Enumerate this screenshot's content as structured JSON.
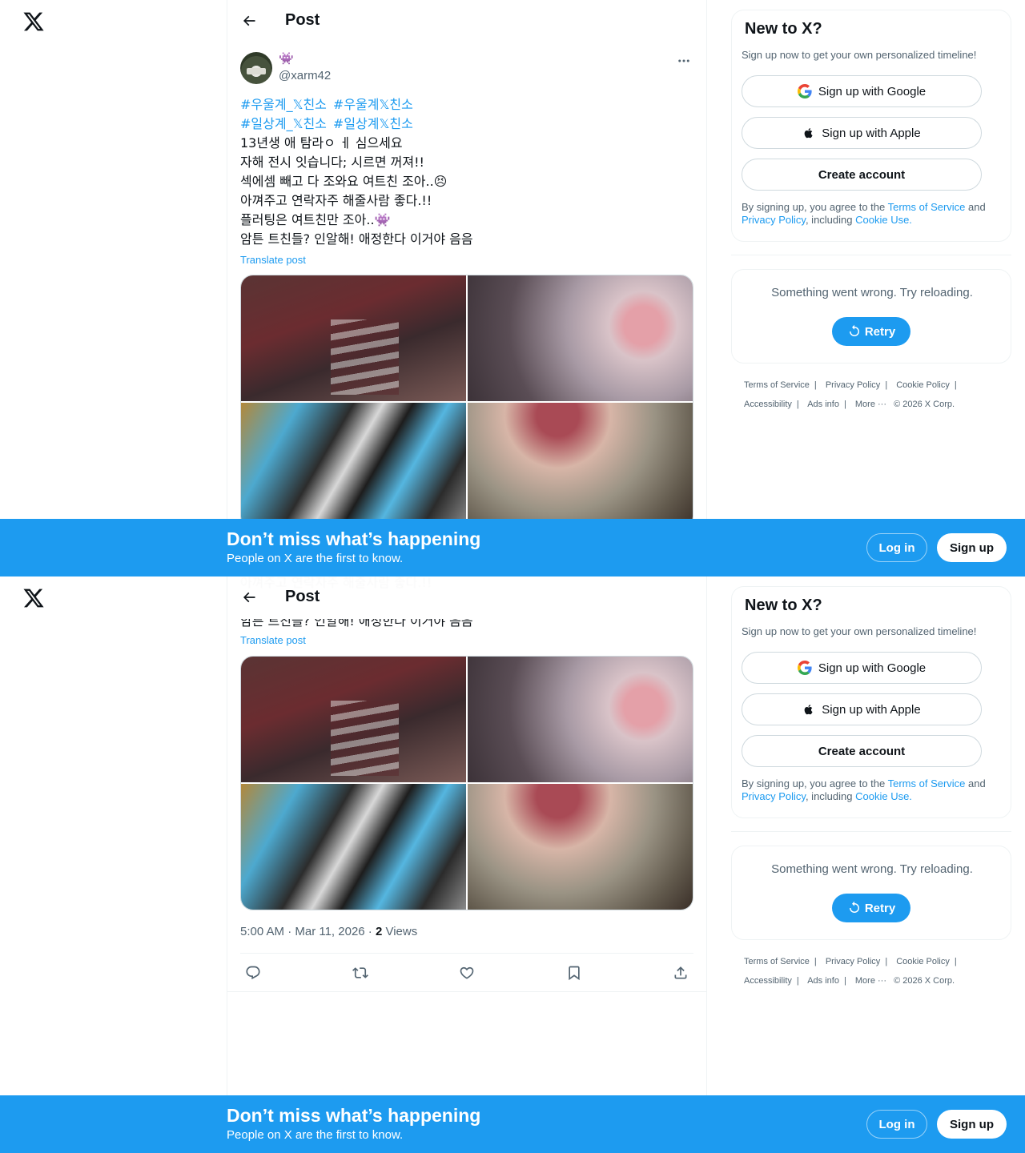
{
  "header": {
    "title": "Post"
  },
  "post": {
    "display_name": "👾",
    "handle": "@xarm42",
    "hashtags_line1": [
      "#우울계_𝕏친소",
      "#우울계𝕏친소"
    ],
    "hashtags_line2": [
      "#일상계_𝕏친소",
      "#일상계𝕏친소"
    ],
    "lines": [
      "13년생 애 탐라ㅇ ㅔ 심으세요",
      "자해 전시 잇습니다; 시르면 꺼져!!",
      "섹에셈 빼고 다 조와요 여트친 조아..😣",
      "아껴주고 연락자주 해줄사람 좋다.!!",
      "플러팅은 여트친만 조아..👾",
      "암튼 트친들? 인알해! 애정한다 이거야 음음"
    ],
    "translate": "Translate post",
    "time": "5:00 AM · Mar 11, 2026 · ",
    "views_count": "2",
    "views_label": " Views"
  },
  "signup_card": {
    "title": "New to X?",
    "subtitle": "Sign up now to get your own personalized timeline!",
    "google": "Sign up with Google",
    "apple": "Sign up with Apple",
    "create": "Create account",
    "legal_prefix": "By signing up, you agree to the ",
    "terms": "Terms of Service",
    "and": " and ",
    "privacy": "Privacy Policy",
    "including": ", including ",
    "cookie": "Cookie Use."
  },
  "error_card": {
    "message": "Something went wrong. Try reloading.",
    "retry": "Retry"
  },
  "footer": {
    "terms": "Terms of Service",
    "privacy": "Privacy Policy",
    "cookie": "Cookie Policy",
    "accessibility": "Accessibility",
    "ads": "Ads info",
    "more": "More ···",
    "copyright": "© 2026 X Corp."
  },
  "banner": {
    "title": "Don’t miss what’s happening",
    "subtitle": "People on X are the first to know.",
    "login": "Log in",
    "signup": "Sign up"
  },
  "colors": {
    "accent": "#1d9bf0",
    "text": "#0f1419",
    "muted": "#536471"
  }
}
